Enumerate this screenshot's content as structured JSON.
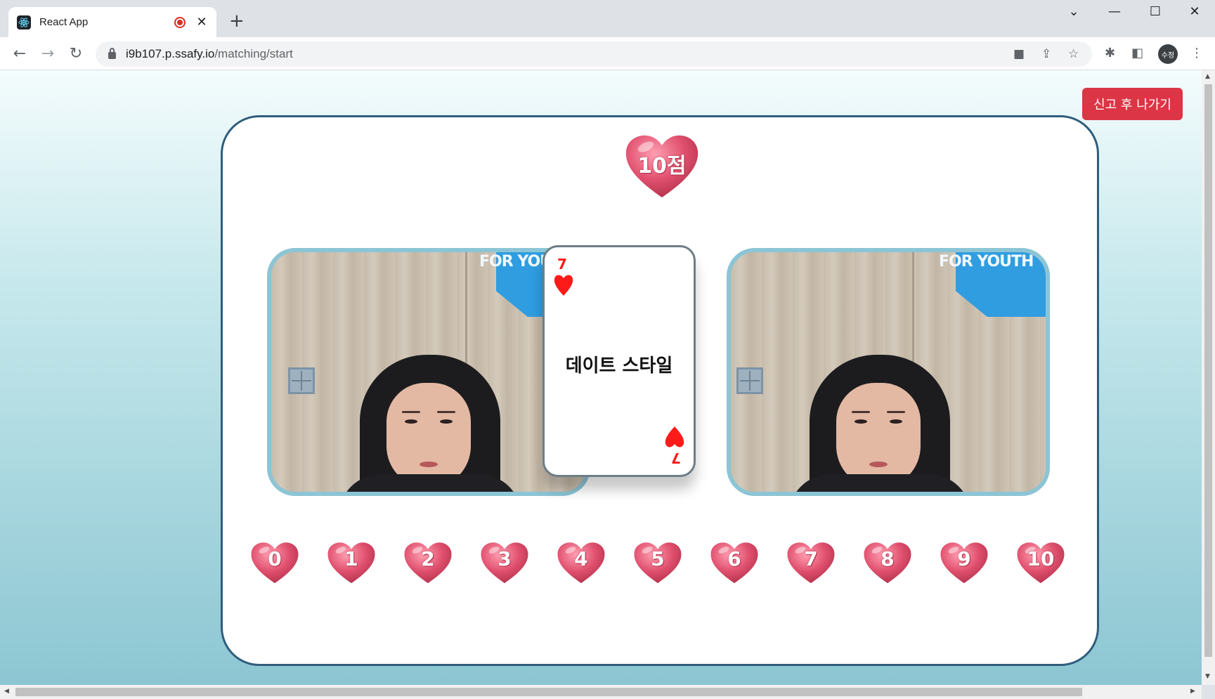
{
  "browser": {
    "tab_title": "React App",
    "tab_close": "✕",
    "new_tab": "+",
    "url_host": "i9b107.p.ssafy.io",
    "url_path": "/matching/start",
    "profile_initials": "수정"
  },
  "page": {
    "report_button": "신고 후 나가기",
    "score": "10점",
    "card": {
      "rank": "7",
      "suit": "heart",
      "suit_color": "#ff1a1a",
      "topic": "데이트 스타일"
    },
    "video_banner_text": "FOR YOUTH",
    "score_options": [
      "0",
      "1",
      "2",
      "3",
      "4",
      "5",
      "6",
      "7",
      "8",
      "9",
      "10"
    ]
  },
  "colors": {
    "report_button": "#dc3545",
    "panel_border": "#2f5d7c",
    "video_border": "#8cc5d5",
    "heart": "#e0506e"
  }
}
